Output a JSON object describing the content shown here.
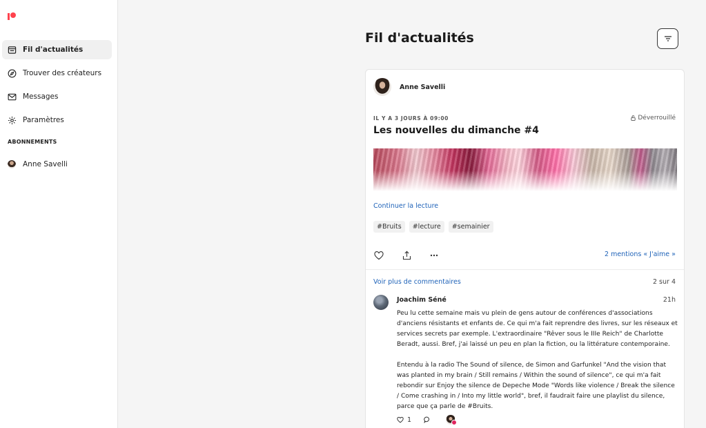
{
  "sidebar": {
    "nav": [
      {
        "label": "Fil d'actualités",
        "icon": "feed-icon",
        "active": true
      },
      {
        "label": "Trouver des créateurs",
        "icon": "compass-icon",
        "active": false
      },
      {
        "label": "Messages",
        "icon": "envelope-icon",
        "active": false
      },
      {
        "label": "Paramètres",
        "icon": "gear-icon",
        "active": false
      }
    ],
    "section_label": "ABONNEMENTS",
    "subscriptions": [
      {
        "name": "Anne Savelli"
      }
    ]
  },
  "main": {
    "title": "Fil d'actualités",
    "filter_icon": "filter-icon"
  },
  "post": {
    "author": "Anne Savelli",
    "meta": "IL Y A 3 JOURS À 09:00",
    "status": "Déverrouillé",
    "status_icon": "lock-open-icon",
    "title": "Les nouvelles du dimanche #4",
    "continue_label": "Continuer la lecture",
    "tags": [
      "#Bruits",
      "#lecture",
      "#semainier"
    ],
    "likes_label": "2 mentions « J'aime »"
  },
  "comments": {
    "more_label": "Voir plus de commentaires",
    "count_label": "2 sur 4",
    "items": [
      {
        "author": "Joachim Séné",
        "time": "21h",
        "paragraphs": [
          "Peu lu cette semaine mais vu plein de gens autour de conférences d'associations d'anciens résistants et enfants de. Ce qui m'a fait reprendre des livres, sur les réseaux et services secrets par exemple. L'extraordinaire \"Rêver sous le IIIe Reich\" de Charlotte Beradt, aussi. Bref, j'ai laissé un peu en plan la fiction, ou la littérature contemporaine.",
          "Entendu à la radio The Sound of silence, de Simon and Garfunkel \"And the vision that was planted in my brain / Still remains / Within the sound of silence\", ce qui m'a fait rebondir sur Enjoy the silence de Depeche Mode \"Words like violence / Break the silence / Come crashing in / Into my little world\", bref, il faudrait faire une playlist du silence, parce que ça parle de #Bruits."
        ],
        "likes": "1"
      }
    ]
  },
  "colors": {
    "brand": "#ff424d",
    "link": "#1e62b8"
  }
}
